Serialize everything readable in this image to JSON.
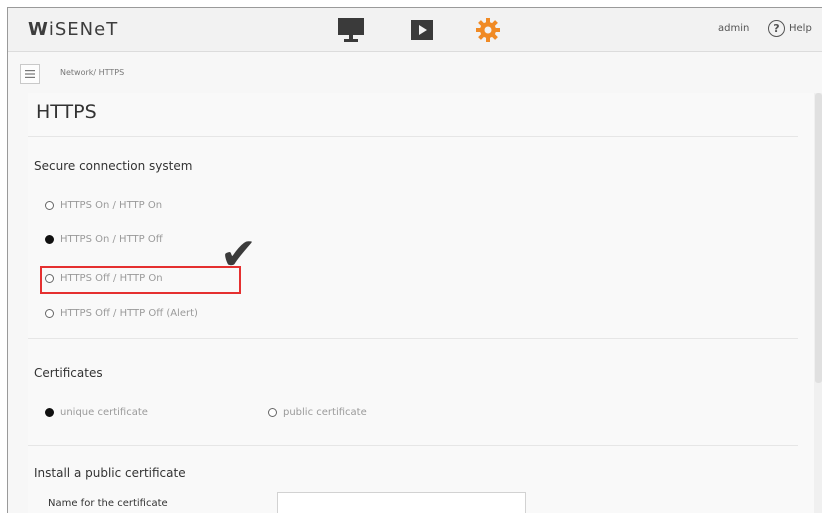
{
  "header": {
    "logo_prefix": "W",
    "logo_rest": "iSENeT",
    "nav_icons": [
      "monitor-icon",
      "play-icon",
      "setup-gear-icon"
    ],
    "user": "admin",
    "help_label": "Help",
    "help_glyph": "?"
  },
  "breadcrumb": "Network/ HTTPS",
  "page": {
    "title": "HTTPS",
    "secure_connection": {
      "title": "Secure connection system",
      "options": [
        {
          "label": "HTTPS On / HTTP On",
          "checked": false
        },
        {
          "label": "HTTPS On / HTTP Off",
          "checked": true
        },
        {
          "label": "HTTPS Off / HTTP On",
          "checked": false
        },
        {
          "label": "HTTPS Off / HTTP Off (Alert)",
          "checked": false
        }
      ]
    },
    "certificates": {
      "title": "Certificates",
      "options": [
        {
          "label": "unique certificate",
          "checked": true
        },
        {
          "label": "public certificate",
          "checked": false
        }
      ]
    },
    "install": {
      "title": "Install a public certificate",
      "name_label": "Name for the certificate",
      "name_value": ""
    }
  },
  "annotation": {
    "checkmark": "✔",
    "highlight_color": "#e53030"
  },
  "colors": {
    "accent_orange": "#f08a24",
    "icon_dark": "#3a3a3a"
  }
}
